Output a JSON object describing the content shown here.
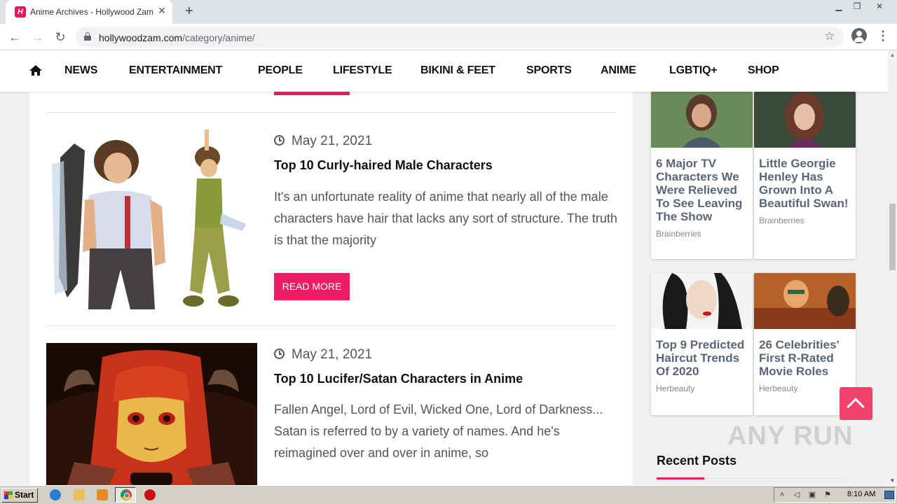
{
  "browser": {
    "tab_title": "Anime Archives - Hollywood Zam",
    "favicon_letter": "H",
    "url_domain": "hollywoodzam.com",
    "url_path": "/category/anime/"
  },
  "site_nav": {
    "items": [
      "NEWS",
      "ENTERTAINMENT",
      "PEOPLE",
      "LIFESTYLE",
      "BIKINI & FEET",
      "SPORTS",
      "ANIME",
      "LGBTIQ+",
      "SHOP"
    ]
  },
  "posts": [
    {
      "date": "May 21, 2021",
      "title": "Top 10 Curly-haired Male Characters",
      "excerpt": "It's an unfortunate reality of anime that nearly all of the male characters have hair that lacks any sort of structure. The truth is that the majority",
      "button": "READ MORE"
    },
    {
      "date": "May 21, 2021",
      "title": "Top 10 Lucifer/Satan Characters in Anime",
      "excerpt": "Fallen Angel, Lord of Evil, Wicked One, Lord of Darkness... Satan is referred to by a variety of names. And he's reimagined over and over in anime, so"
    }
  ],
  "sidebar": {
    "ads": [
      {
        "title": "6 Major TV Characters We Were Relieved To See Leaving The Show",
        "source": "Brainberries"
      },
      {
        "title": "Little Georgie Henley Has Grown Into A Beautiful Swan!",
        "source": "Brainberries"
      },
      {
        "title": "Top 9 Predicted Haircut Trends Of 2020",
        "source": "Herbeauty"
      },
      {
        "title": "26 Celebrities' First R-Rated Movie Roles",
        "source": "Herbeauty"
      }
    ],
    "recent_posts_title": "Recent Posts"
  },
  "watermark": "ANY RUN",
  "taskbar": {
    "start_label": "Start",
    "clock": "8:10 AM"
  },
  "colors": {
    "accent": "#e91e63",
    "back_to_top": "#f0436c"
  }
}
